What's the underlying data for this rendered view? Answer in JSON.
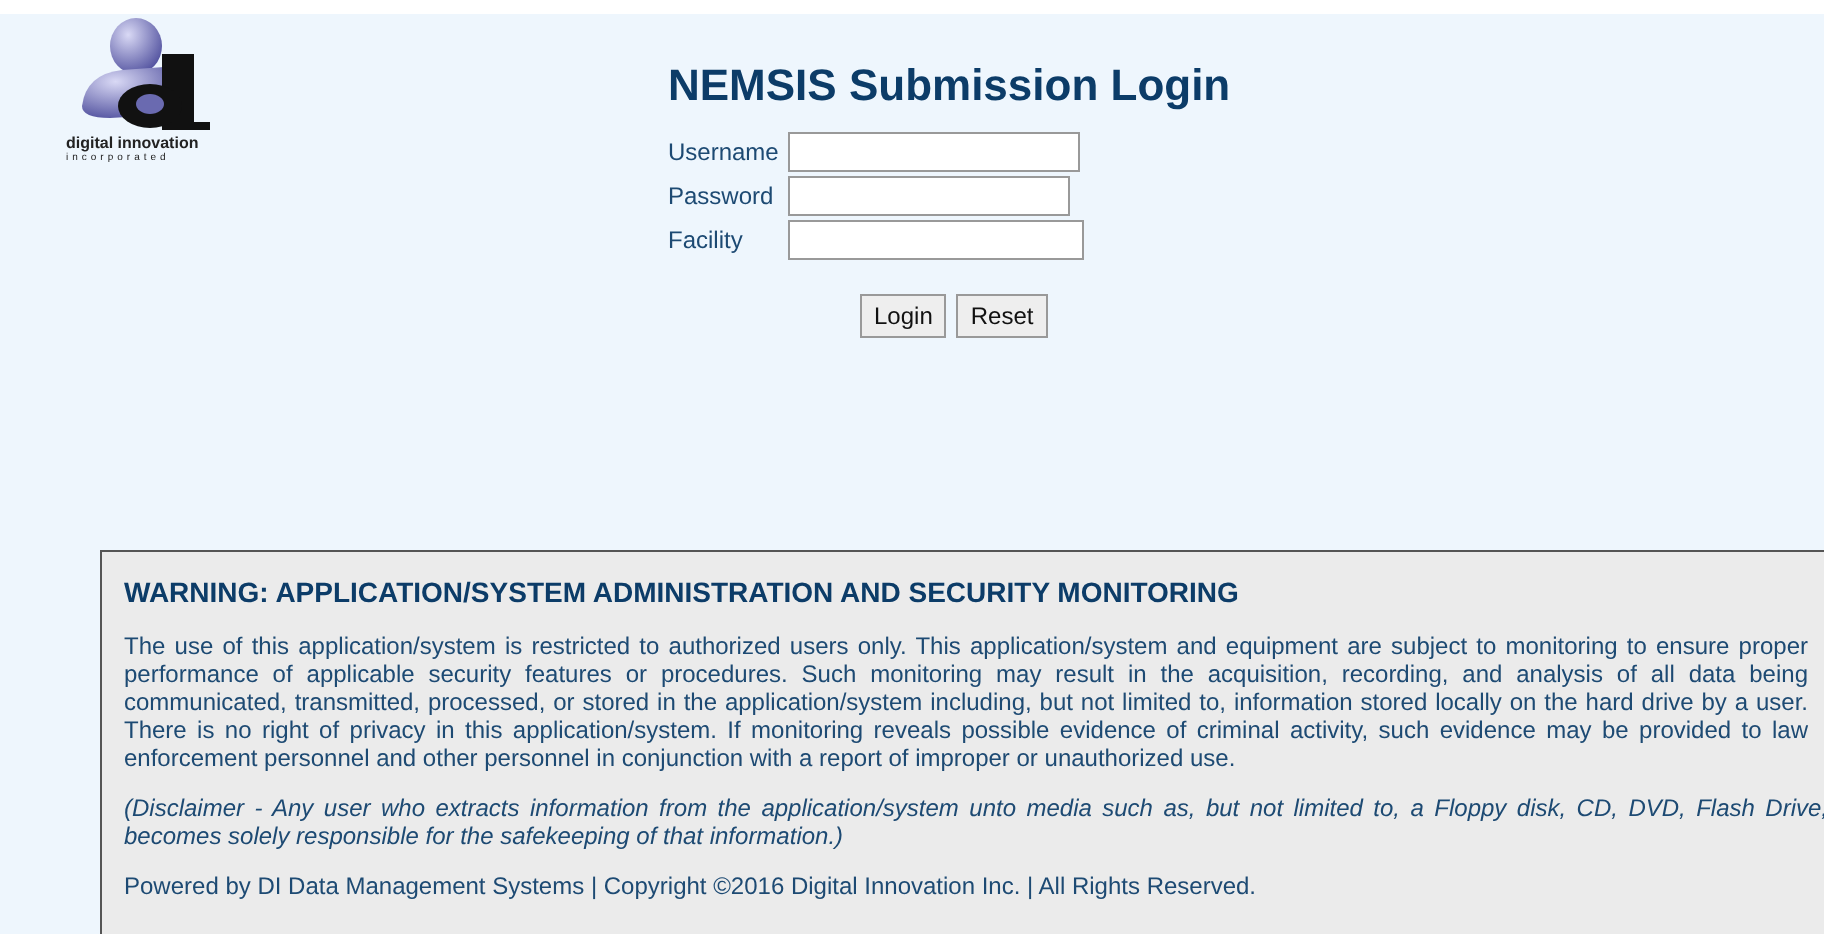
{
  "logo": {
    "name": "digital innovation",
    "subtitle": "incorporated"
  },
  "login": {
    "title": "NEMSIS Submission Login",
    "fields": [
      {
        "label": "Username"
      },
      {
        "label": "Password"
      },
      {
        "label": "Facility"
      }
    ],
    "buttons": [
      "Login",
      "Reset"
    ]
  },
  "warning": {
    "heading": "WARNING: APPLICATION/SYSTEM ADMINISTRATION AND SECURITY MONITORING",
    "body": "The use of this application/system is restricted to authorized users only. This application/system and equipment are subject to monitoring to ensure proper performance of applicable security features or procedures. Such monitoring may result in the acquisition, recording, and analysis of all data being communicated, transmitted, processed, or stored in the application/system including, but not limited to, information stored locally on the hard drive by a user. There is no right of privacy in this application/system. If monitoring reveals possible evidence of criminal activity, such evidence may be provided to law enforcement personnel and other personnel in conjunction with a report of improper or unauthorized use.",
    "disclaimer": "(Disclaimer - Any user who extracts information from the application/system unto media such as, but not limited to, a Floppy disk, CD, DVD, Flash Drive, becomes solely responsible for the safekeeping of that information.)",
    "footer": "Powered by DI Data Management Systems | Copyright ©2016 Digital Innovation Inc. | All Rights Reserved."
  }
}
